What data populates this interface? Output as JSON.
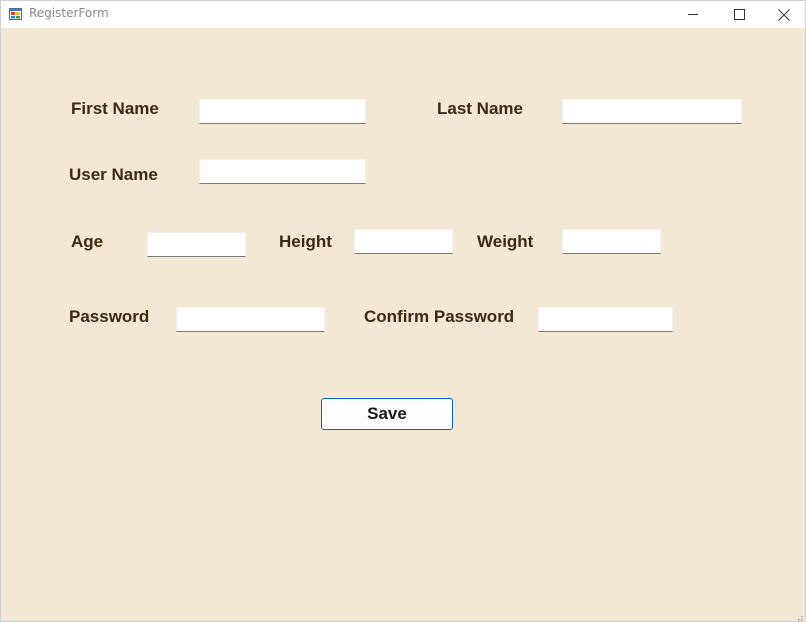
{
  "window": {
    "title": "RegisterForm",
    "background": "#f2e8d5",
    "icons": {
      "app": "app-form-icon",
      "minimize": "minimize-icon",
      "maximize": "maximize-icon",
      "close": "close-icon"
    }
  },
  "form": {
    "first_name_label": "First Name",
    "first_name_value": "",
    "last_name_label": "Last Name",
    "last_name_value": "",
    "user_name_label": "User Name",
    "user_name_value": "",
    "age_label": "Age",
    "age_value": "",
    "height_label": "Height",
    "height_value": "",
    "weight_label": "Weight",
    "weight_value": "",
    "password_label": "Password",
    "password_value": "",
    "confirm_password_label": "Confirm Password",
    "confirm_password_value": "",
    "save_label": "Save",
    "accent": "#0a64c8"
  }
}
